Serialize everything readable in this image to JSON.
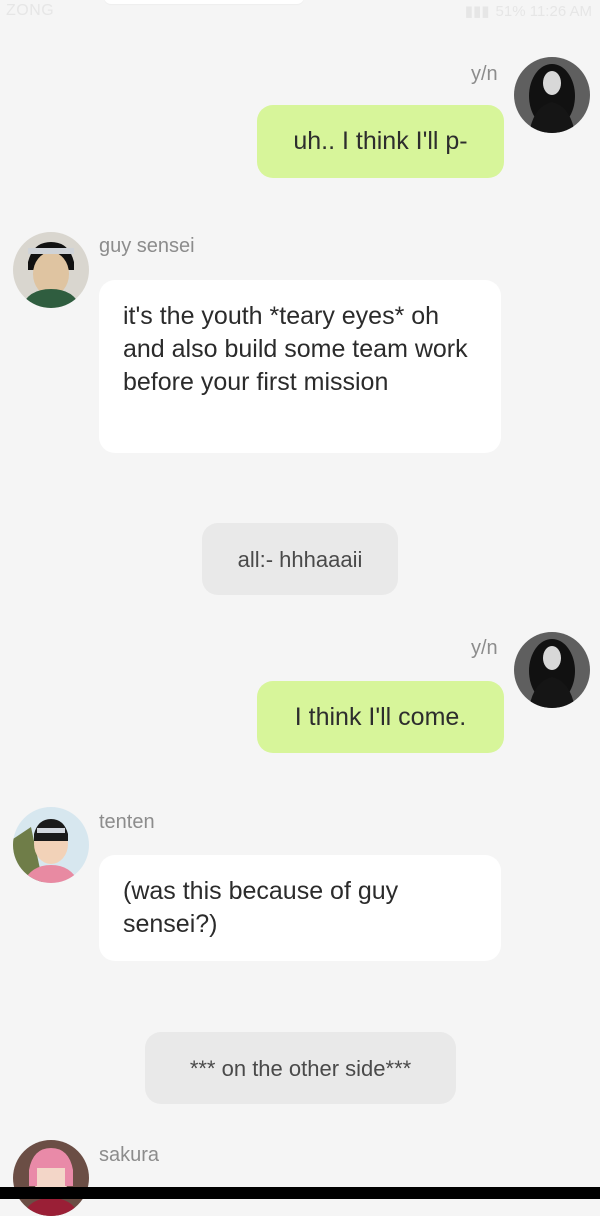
{
  "status_bar": {
    "carrier": "ZONG",
    "right_text": "51% 11:26 AM"
  },
  "messages": [
    {
      "sender": "y/n",
      "side": "right",
      "text": "uh.. I think I'll p-"
    },
    {
      "sender": "guy sensei",
      "side": "left",
      "text": "it's the youth *teary eyes* oh and also build some team work before your first mission"
    },
    {
      "side": "center",
      "text": "all:- hhhaaaii"
    },
    {
      "sender": "y/n",
      "side": "right",
      "text": "I think I'll come."
    },
    {
      "sender": "tenten",
      "side": "left",
      "text": "(was this because of guy sensei?)"
    },
    {
      "side": "center",
      "text": "*** on the other side***"
    },
    {
      "sender": "sakura",
      "side": "left",
      "text": ""
    }
  ],
  "colors": {
    "background": "#f5f5f5",
    "outgoing_bubble": "#d7f59a",
    "incoming_bubble": "#ffffff",
    "narration_bubble": "#e9e9e9",
    "name_text": "#8c8c8c"
  },
  "avatars": {
    "yn": "dark-hair-avatar-icon",
    "guy": "guy-sensei-avatar-icon",
    "tenten": "tenten-avatar-icon",
    "sakura": "sakura-avatar-icon"
  }
}
